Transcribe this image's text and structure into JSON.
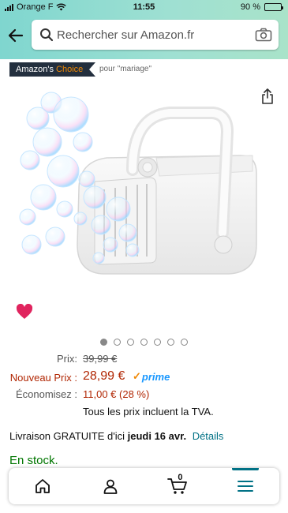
{
  "status_bar": {
    "carrier": "Orange F",
    "time": "11:55",
    "battery": "90 %",
    "battery_level": 0.9
  },
  "header": {
    "search_placeholder": "Rechercher sur Amazon.fr",
    "icons": [
      "back-arrow-icon",
      "search-icon",
      "camera-icon"
    ]
  },
  "badge": {
    "amazons": "Amazon's",
    "choice": "Choice",
    "context": "pour \"mariage\""
  },
  "carousel": {
    "dot_count": 7,
    "active_index": 0
  },
  "price": {
    "prix_label": "Prix:",
    "prix_old": "39,99 €",
    "nouveau_label": "Nouveau Prix :",
    "nouveau_value": "28,99 €",
    "prime_label": "prime",
    "economisez_label": "Économisez :",
    "economisez_value": "11,00 € (28 %)",
    "tva": "Tous les prix incluent la TVA."
  },
  "delivery": {
    "prefix": "Livraison GRATUITE d'ici",
    "date": "jeudi 16 avr.",
    "details_link": "Détails"
  },
  "stock": "En stock.",
  "bottom_nav": {
    "cart_count": "0",
    "items": [
      "home-icon",
      "account-icon",
      "cart-icon",
      "menu-icon"
    ],
    "active": "menu-icon"
  },
  "colors": {
    "header_gradient_start": "#7fd6cf",
    "header_gradient_end": "#a9e3c9",
    "badge_bg": "#232f3e",
    "choice_orange": "#f08804",
    "price_red": "#b12704",
    "link_teal": "#007185",
    "stock_green": "#007600",
    "prime_blue": "#1a98ff",
    "heart_pink": "#e0245e"
  }
}
